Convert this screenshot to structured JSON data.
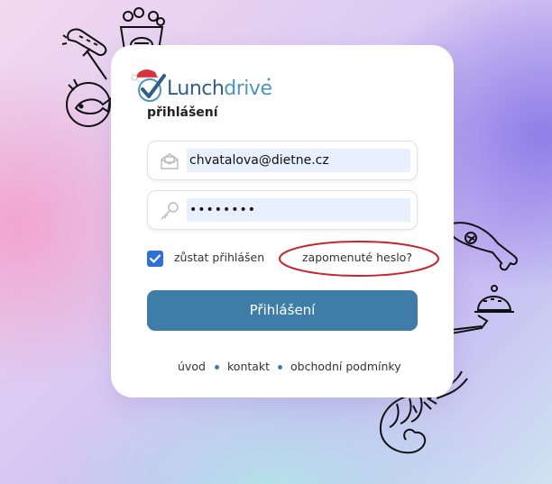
{
  "brand": {
    "name_part1": "Lunch",
    "name_part2": "drive",
    "color_dark": "#2f5f86",
    "color_light": "#4f94bb"
  },
  "login": {
    "heading": "přihlášení",
    "email_value": "chvatalova@dietne.cz",
    "password_value": "••••••••",
    "remember_label": "zůstat přihlášen",
    "remember_checked": true,
    "forgot_label": "zapomenuté heslo?",
    "submit_label": "Přihlášení"
  },
  "footer": {
    "links": [
      "úvod",
      "kontakt",
      "obchodní podmínky"
    ]
  },
  "colors": {
    "button": "#3e7da8",
    "checkbox": "#2f6fd6",
    "highlight_ellipse": "#c8232a"
  },
  "icons": {
    "email": "envelope-icon",
    "password": "key-icon",
    "check": "check-icon"
  }
}
